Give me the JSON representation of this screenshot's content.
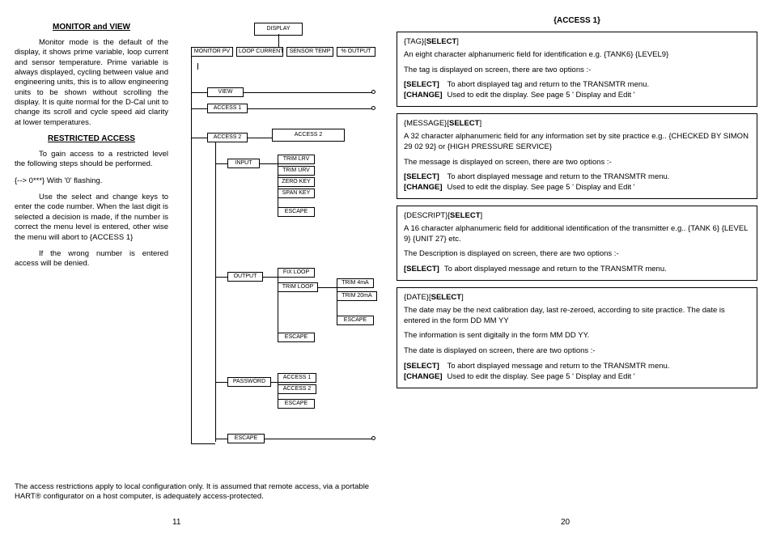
{
  "left": {
    "heading_monitor": "MONITOR and VIEW",
    "para_monitor": "Monitor mode is the default of the display, it shows prime variable, loop current and sensor temperature. Prime variable is always displayed, cycling between value and engineering units, this is to allow engineering units to be shown without scrolling the display. It is quite normal for the D-Cal unit to change its scroll and cycle speed aid clarity at lower temperatures.",
    "heading_restricted": "RESTRICTED ACCESS",
    "para_restricted1": "To gain access to a restricted level the following steps should be performed.",
    "para_code": "{--> 0***} With '0' flashing.",
    "para_restricted2": "Use the select and change keys to enter the code number. When the last digit is selected a decision is made, if the number is correct the menu level is entered, other wise the menu will abort to {ACCESS 1}",
    "para_restricted3": "If the wrong number is entered access will be denied.",
    "footer": "The access restrictions apply to local configuration only. It is assumed that remote access, via a portable HART® configurator on a host computer, is adequately access-protected.",
    "page_num": "11"
  },
  "flow": {
    "display": "DISPLAY",
    "monitor_pv": "MONITOR PV",
    "loop_current": "LOOP CURRENT",
    "sensor_temp": "SENSOR TEMP",
    "pct_output": "% OUTPUT",
    "view": "VIEW",
    "access1": "ACCESS 1",
    "access2label": "ACCESS 2",
    "access2box": "ACCESS 2",
    "input": "INPUT",
    "trim_lrv": "TRIM LRV",
    "trim_urv": "TRIM URV",
    "zero_key": "ZERO KEY",
    "span_key": "SPAN KEY",
    "escape": "ESCAPE",
    "output": "OUTPUT",
    "fix_loop": "FIX LOOP",
    "trim_loop": "TRIM LOOP",
    "trim_4ma": "TRIM 4mA",
    "trim_20ma": "TRIM 20mA",
    "escape2": "ESCAPE",
    "escape3": "ESCAPE",
    "password": "PASSWORD",
    "pw_access1": "ACCESS 1",
    "pw_access2": "ACCESS 2",
    "pw_escape": "ESCAPE",
    "escape4": "ESCAPE"
  },
  "right": {
    "title": "{ACCESS  1}",
    "page_num": "20",
    "tag": {
      "hdr_a": "{TAG}[",
      "hdr_b": "SELECT",
      "hdr_c": "]",
      "line1": "An eight character alphanumeric field for identification  e.g. {TANK6} {LEVEL9}",
      "line2": "The tag is displayed on screen, there are two options :-",
      "select_lbl": "[SELECT]",
      "select_txt": "To abort displayed tag and return to the TRANSMTR menu.",
      "change_lbl": "[CHANGE]",
      "change_txt": "Used to edit the display. See page 5  ' Display and Edit '"
    },
    "message": {
      "hdr_a": "{MESSAGE}[",
      "hdr_b": "SELECT",
      "hdr_c": "]",
      "line1": "A 32 character alphanumeric field for any information set by site practice e.g.. {CHECKED BY SIMON 29 02 92} or {HIGH PRESSURE SERVICE}",
      "line2": "The message is displayed on screen, there are two options :-",
      "select_lbl": "[SELECT]",
      "select_txt": "To abort displayed message and return to the TRANSMTR menu.",
      "change_lbl": "[CHANGE]",
      "change_txt": "Used to edit the display. See page 5  ' Display and Edit '"
    },
    "descript": {
      "hdr_a": "{DESCRIPT}[",
      "hdr_b": "SELECT",
      "hdr_c": "]",
      "line1": "A 16 character alphanumeric field  for additional identification of the transmitter e.g.. {TANK 6} {LEVEL 9} {UNIT 27} etc.",
      "line2": "The Description is displayed on screen, there are two options :-",
      "select_lbl": "[SELECT]",
      "select_txt": "To abort displayed message and return to the TRANSMTR menu."
    },
    "date": {
      "hdr_a": "{DATE}[",
      "hdr_b": "SELECT",
      "hdr_c": "]",
      "line1": "The date may be the next calibration day, last re-zeroed, according to site practice. The date is entered in the form DD MM YY",
      "line2": "The information is sent digitally in the form MM DD YY.",
      "line3": "The date is displayed on screen, there are two options :-",
      "select_lbl": "[SELECT]",
      "select_txt": "To abort displayed message and return to the TRANSMTR  menu.",
      "change_lbl": "[CHANGE]",
      "change_txt": "Used to edit the display. See page 5  ' Display and Edit '"
    }
  }
}
